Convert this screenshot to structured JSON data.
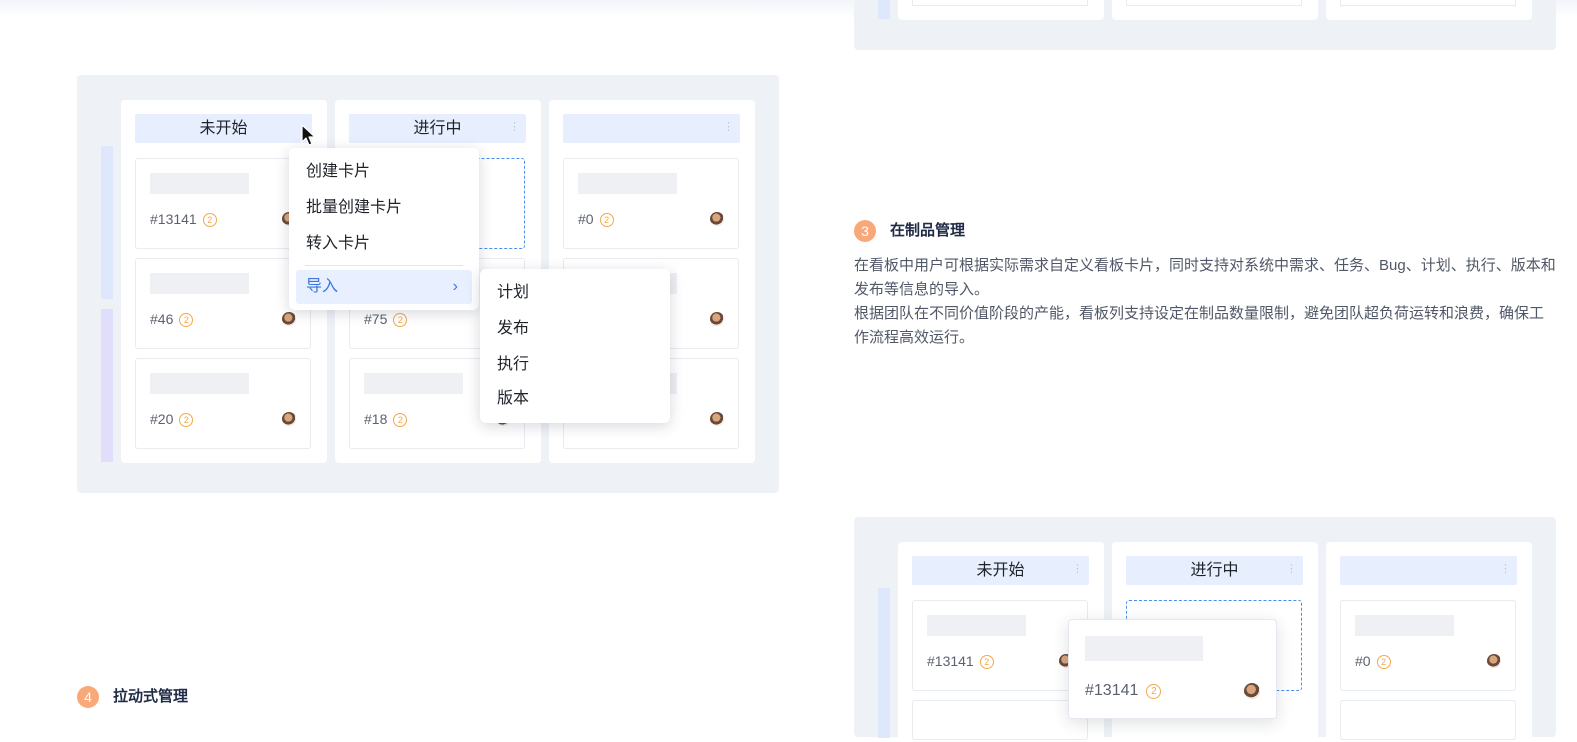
{
  "board_main": {
    "columns": [
      {
        "title": "未开始",
        "cards": [
          {
            "id": "#13141",
            "prio": "2"
          },
          {
            "id": "#46",
            "prio": "2"
          },
          {
            "id": "#20",
            "prio": "2"
          }
        ]
      },
      {
        "title": "进行中",
        "cards": [
          {
            "id": "#75",
            "prio": "2"
          },
          {
            "id": "#18",
            "prio": "2"
          }
        ]
      },
      {
        "title": "",
        "cards": [
          {
            "id": "#0",
            "prio": "2"
          }
        ]
      }
    ]
  },
  "context_menu": {
    "items": [
      "创建卡片",
      "批量创建卡片",
      "转入卡片"
    ],
    "import_label": "导入",
    "chevron": "›"
  },
  "import_submenu": {
    "items": [
      "计划",
      "发布",
      "执行",
      "版本"
    ]
  },
  "section3": {
    "step": "3",
    "title": "在制品管理",
    "paragraph1": "在看板中用户可根据实际需求自定义看板卡片，同时支持对系统中需求、任务、Bug、计划、执行、版本和发布等信息的导入。",
    "paragraph2": "根据团队在不同价值阶段的产能，看板列支持设定在制品数量限制，避免团队超负荷运转和浪费，确保工作流程高效运行。"
  },
  "section4": {
    "step": "4",
    "title": "拉动式管理"
  },
  "board_bottom": {
    "columns": [
      {
        "title": "未开始",
        "cards": [
          {
            "id": "#13141",
            "prio": "2"
          }
        ]
      },
      {
        "title": "进行中"
      },
      {
        "title": "",
        "cards": [
          {
            "id": "#0",
            "prio": "2"
          }
        ]
      }
    ],
    "dragging_card": {
      "id": "#13141",
      "prio": "2"
    }
  },
  "icons": {
    "kebab": "⋮"
  },
  "colors": {
    "accent": "#3d75e3",
    "step_badge": "#f9a87a",
    "board_bg": "#eef2f7",
    "column_header": "#e7efff"
  }
}
